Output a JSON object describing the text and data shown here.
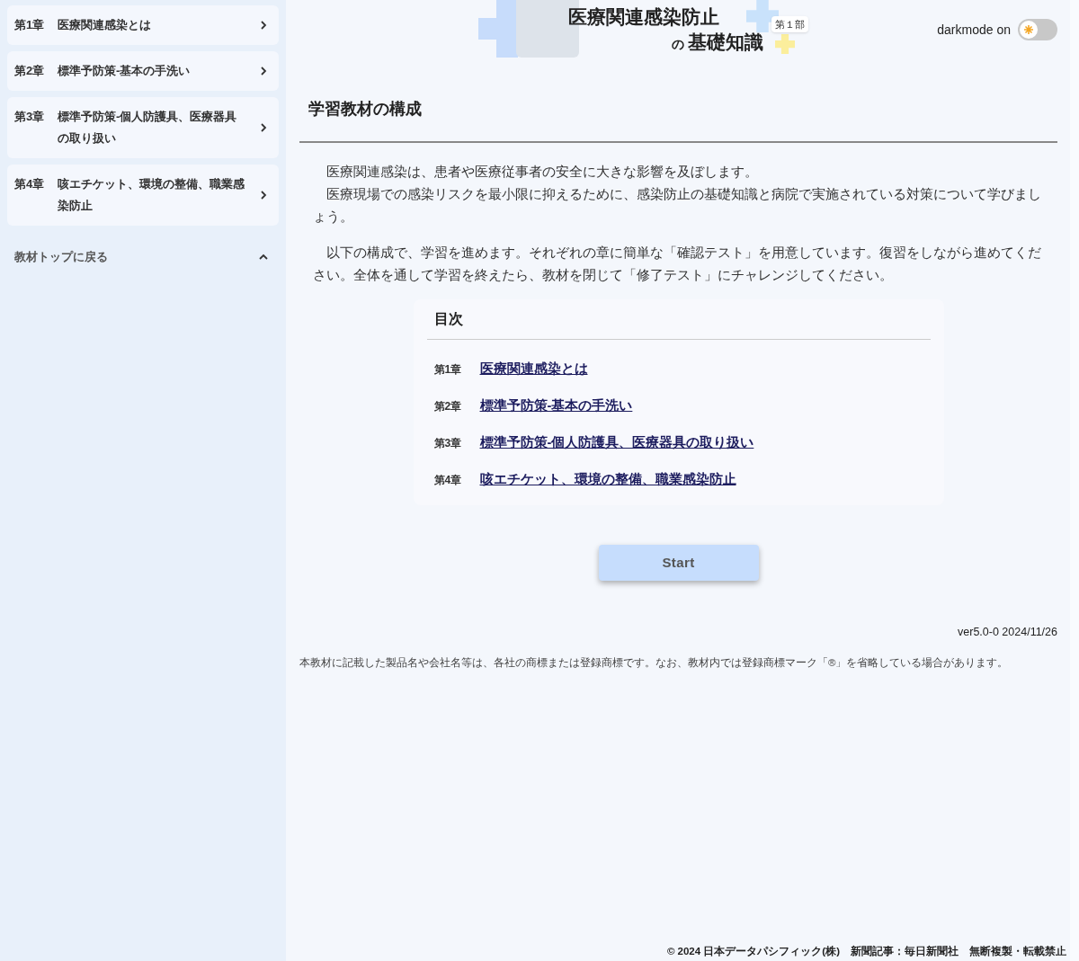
{
  "sidebar": {
    "chapters": [
      {
        "number": "第1章",
        "title": "医療関連感染とは"
      },
      {
        "number": "第2章",
        "title": "標準予防策-基本の手洗い"
      },
      {
        "number": "第3章",
        "title": "標準予防策-個人防護具、医療器具の取り扱い"
      },
      {
        "number": "第4章",
        "title": "咳エチケット、環境の整備、職業感染防止"
      }
    ],
    "back_link": {
      "label": "教材トップに戻る",
      "expanded": true
    }
  },
  "banner": {
    "title_line1": "医療関連感染防止",
    "title_particle": "の",
    "title_line2": "基礎知識",
    "part_badge": "第１部"
  },
  "darkmode": {
    "label": "darkmode on",
    "on": false
  },
  "section_title": "学習教材の構成",
  "paragraphs": [
    {
      "lines": [
        "医療関連感染は、患者や医療従事者の安全に大きな影響を及ぼします。",
        "医療現場での感染リスクを最小限に抑えるために、感染防止の基礎知識と病院で実施されている対策について学びましょう。"
      ]
    },
    {
      "lines": [
        "以下の構成で、学習を進めます。それぞれの章に簡単な「確認テスト」を用意しています。復習をしながら進めてください。全体を通して学習を終えたら、教材を閉じて「修了テスト」にチャレンジしてください。"
      ]
    }
  ],
  "toc": {
    "heading": "目次",
    "items": [
      {
        "number": "第1章",
        "title": "医療関連感染とは"
      },
      {
        "number": "第2章",
        "title": "標準予防策-基本の手洗い"
      },
      {
        "number": "第3章",
        "title": "標準予防策-個人防護具、医療器具の取り扱い"
      },
      {
        "number": "第4章",
        "title": "咳エチケット、環境の整備、職業感染防止"
      }
    ]
  },
  "start_button": "Start",
  "version": "ver5.0-0 2024/11/26",
  "trademark_note": "本教材に記載した製品名や会社名等は、各社の商標または登録商標です。なお、教材内では登録商標マーク「®」を省略している場合があります。",
  "footer": "© 2024 日本データパシフィック(株)　新聞記事：毎日新聞社　無断複製・転載禁止"
}
